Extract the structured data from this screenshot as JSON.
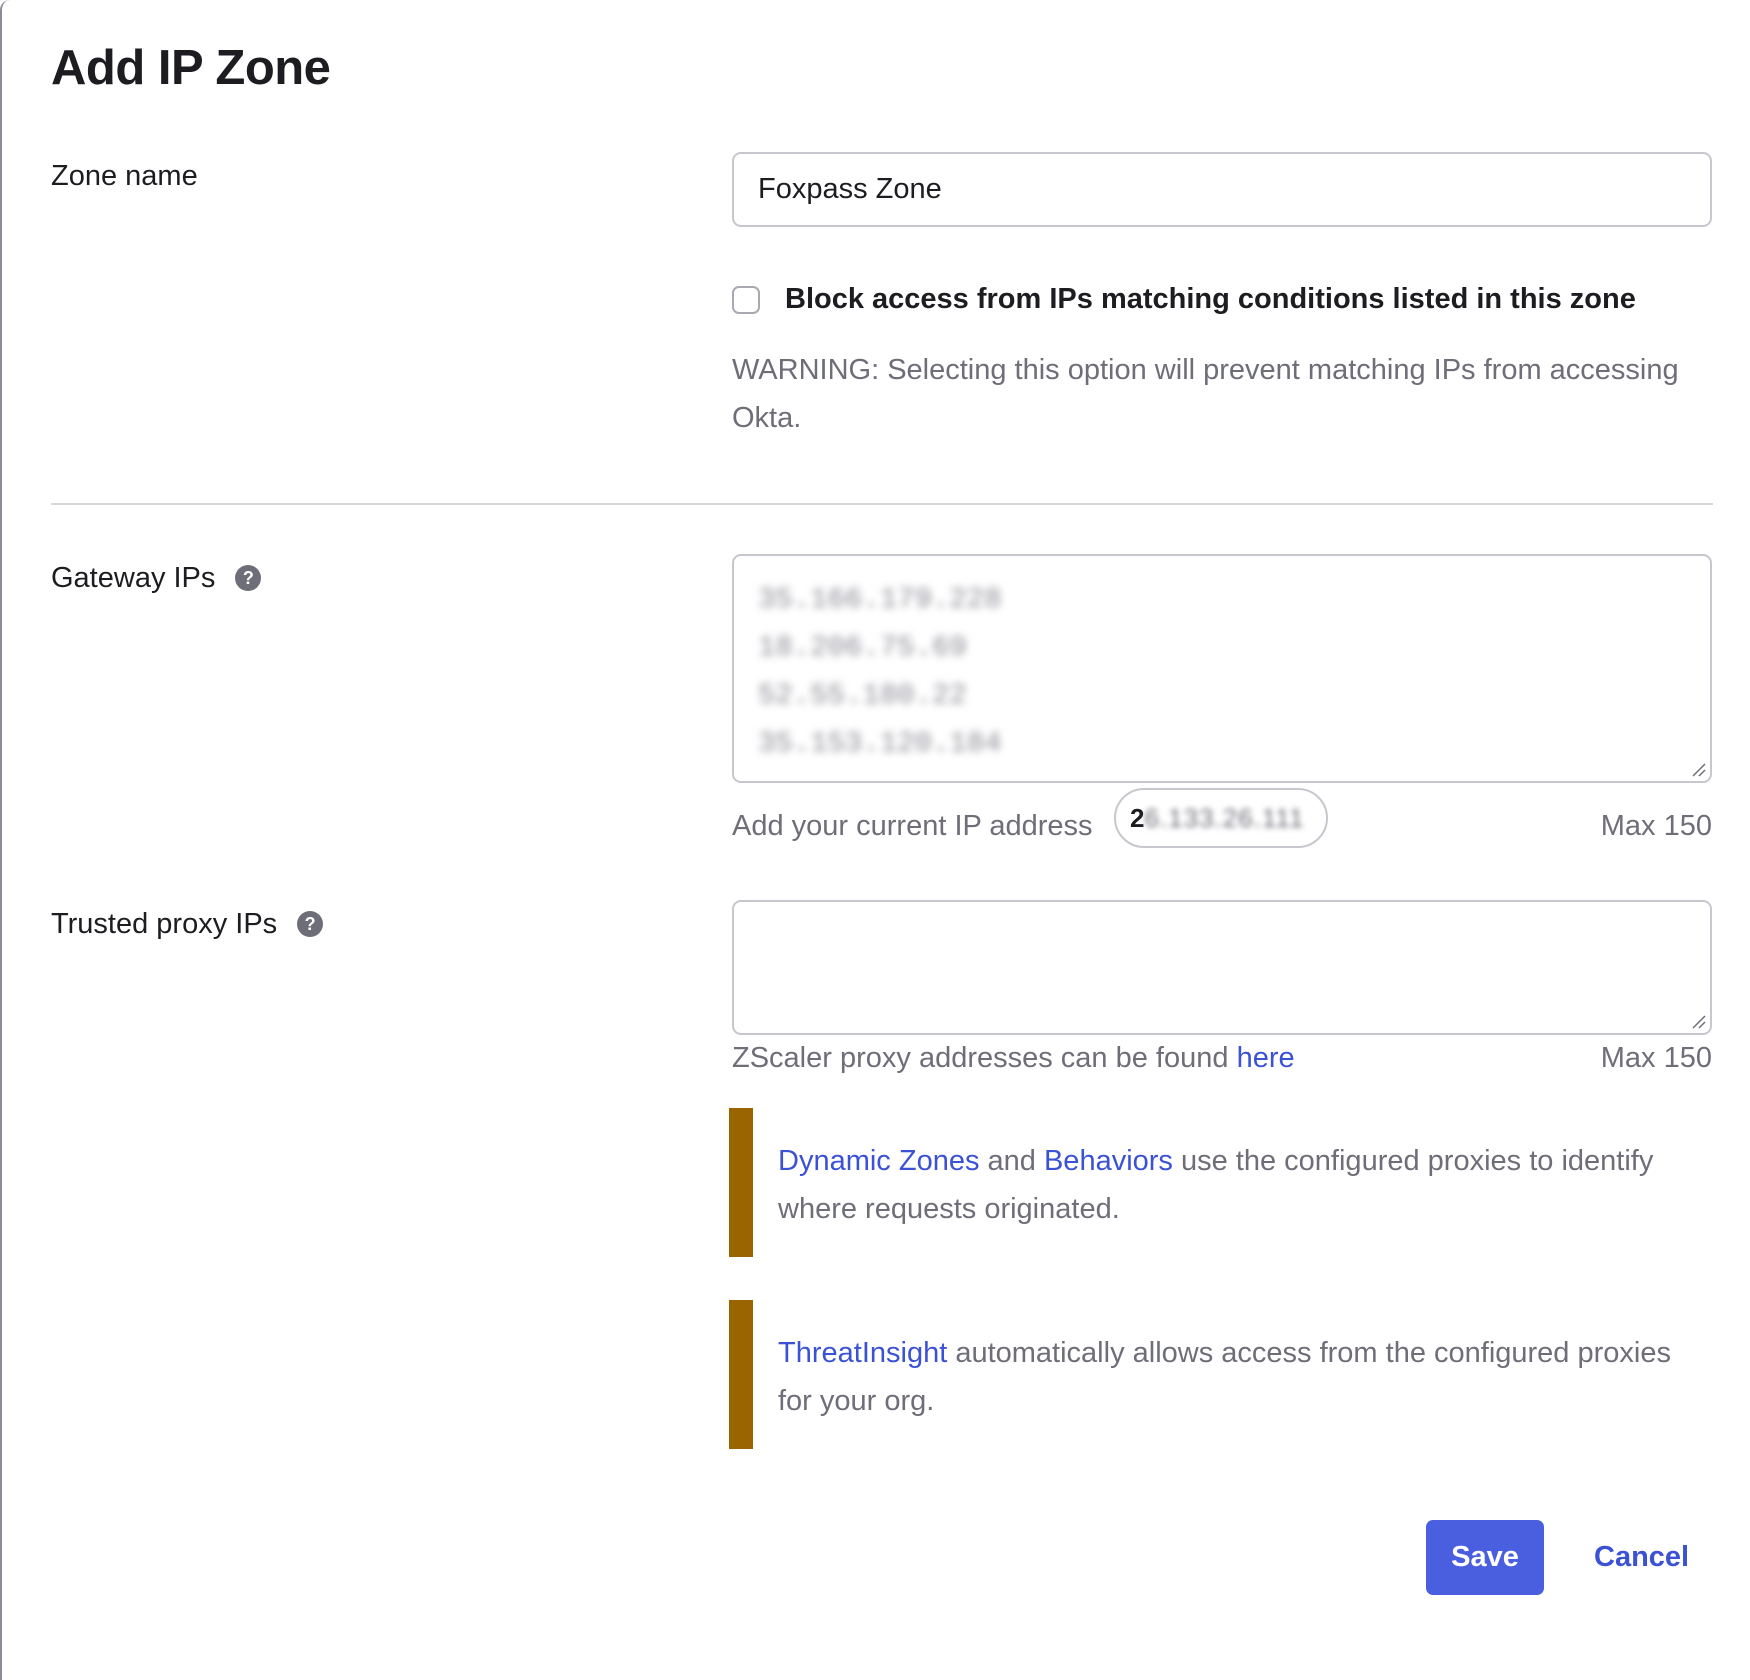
{
  "dialog": {
    "title": "Add IP Zone"
  },
  "zone_name": {
    "label": "Zone name",
    "value": "Foxpass Zone"
  },
  "block_access": {
    "checked": false,
    "label": "Block access from IPs matching conditions listed in this zone",
    "warning": "WARNING: Selecting this option will prevent matching IPs from accessing Okta."
  },
  "gateway_ips": {
    "label": "Gateway IPs",
    "help_icon": "question-circle-icon",
    "help_glyph": "?",
    "values": [
      "35.166.179.228",
      "18.206.75.69",
      "52.55.180.22",
      "35.153.120.184"
    ],
    "add_current_label": "Add your current IP address",
    "current_ip_first": "2",
    "current_ip_rest": "6.133.26.111",
    "max_label": "Max 150"
  },
  "trusted_proxy_ips": {
    "label": "Trusted proxy IPs",
    "help_icon": "question-circle-icon",
    "help_glyph": "?",
    "value": "",
    "hint_prefix": "ZScaler proxy addresses can be found ",
    "hint_link": "here",
    "max_label": "Max 150"
  },
  "callouts": {
    "dynamic": {
      "link1": "Dynamic Zones",
      "and": " and ",
      "link2": "Behaviors",
      "text": " use the configured proxies to identify where requests originated."
    },
    "threat": {
      "link": "ThreatInsight",
      "text": " automatically allows access from the configured proxies for your org."
    }
  },
  "actions": {
    "save": "Save",
    "cancel": "Cancel"
  },
  "colors": {
    "primary": "#4a5fe0",
    "link": "#3b52d6",
    "callout_bar": "#9a6400"
  }
}
